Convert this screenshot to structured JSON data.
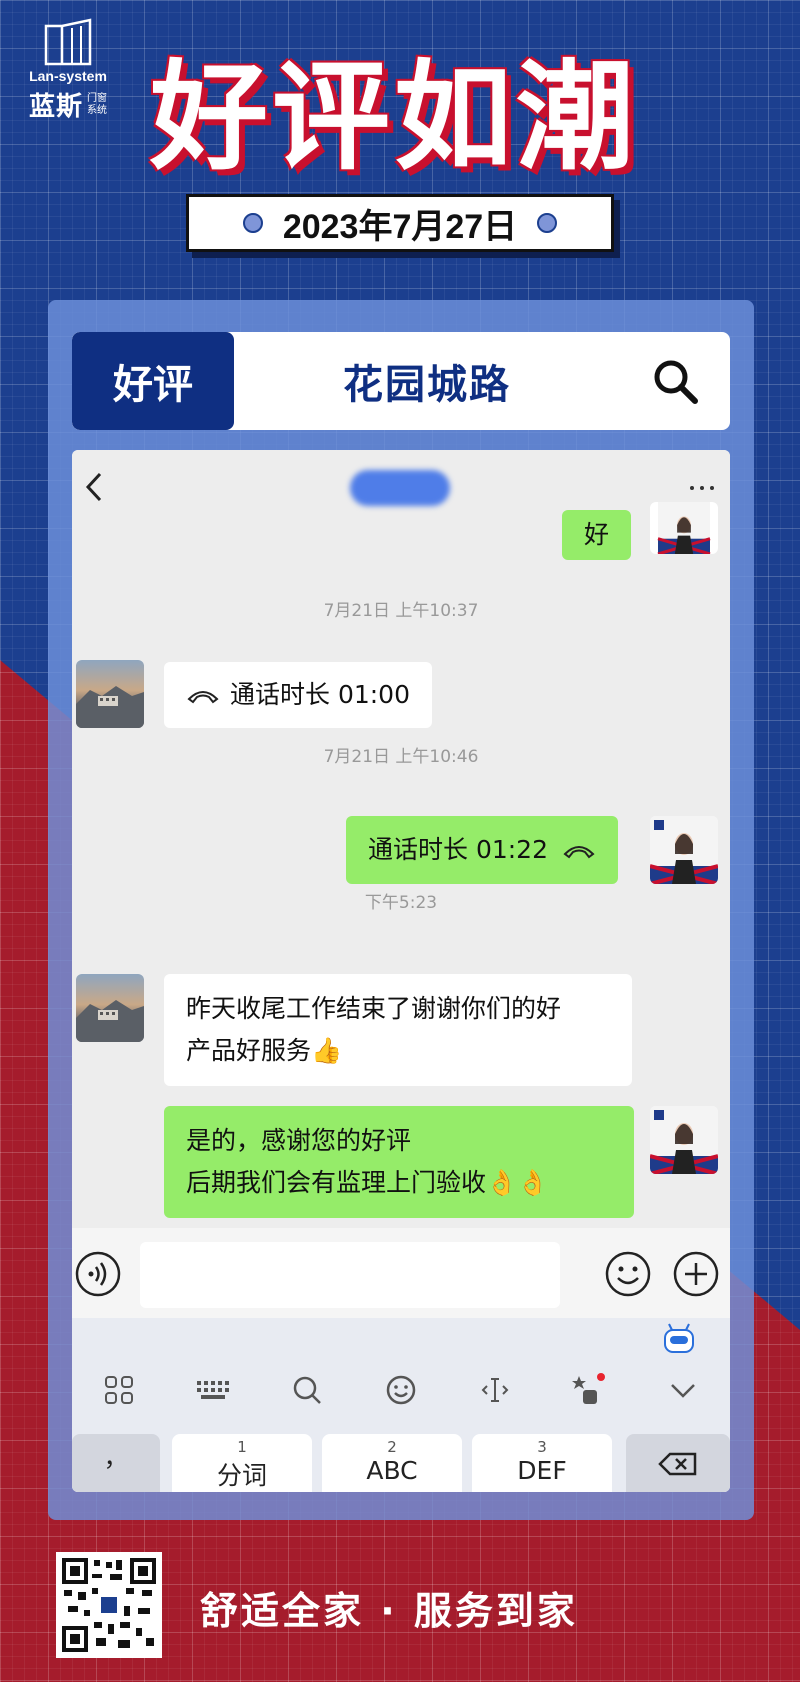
{
  "brand": {
    "en": "Lan-system",
    "cn": "蓝斯",
    "sub_line1": "门窗",
    "sub_line2": "系统"
  },
  "headline": "好评如潮",
  "date": "2023年7月27日",
  "search": {
    "tag": "好评",
    "query": "花园城路"
  },
  "chat": {
    "messages": [
      {
        "side": "right",
        "type": "text",
        "text": "好"
      },
      {
        "type": "time",
        "text": "7月21日 上午10:37"
      },
      {
        "side": "left",
        "type": "call",
        "text": "通话时长 01:00"
      },
      {
        "type": "time",
        "text": "7月21日 上午10:46"
      },
      {
        "side": "right",
        "type": "call",
        "text": "通话时长 01:22"
      },
      {
        "type": "time",
        "text": "下午5:23"
      },
      {
        "side": "left",
        "type": "text",
        "line1": "昨天收尾工作结束了谢谢你们的好",
        "line2": "产品好服务👍"
      },
      {
        "side": "right",
        "type": "text",
        "line1": "是的，感谢您的好评",
        "line2": "后期我们会有监理上门验收👌👌"
      }
    ]
  },
  "keyboard": {
    "keys": [
      {
        "num": "",
        "label": "，"
      },
      {
        "num": "1",
        "label": "分词"
      },
      {
        "num": "2",
        "label": "ABC"
      },
      {
        "num": "3",
        "label": "DEF"
      }
    ]
  },
  "slogan": "舒适全家 · 服务到家",
  "colors": {
    "blue": "#1c3f8f",
    "red": "#a51c2c",
    "green_bubble": "#95ec69",
    "navy": "#0f2f82"
  }
}
